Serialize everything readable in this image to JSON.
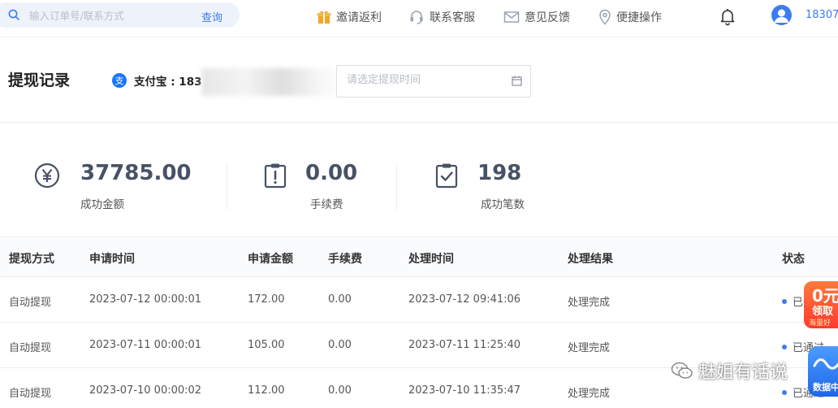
{
  "search": {
    "placeholder": "输入订单号/联系方式",
    "button_label": "查询"
  },
  "nav": {
    "items": [
      {
        "label": "邀请返利",
        "icon": "gift-icon",
        "color": "#f5a623"
      },
      {
        "label": "联系客服",
        "icon": "headset-icon"
      },
      {
        "label": "意见反馈",
        "icon": "mail-icon"
      },
      {
        "label": "便捷操作",
        "icon": "location-pin-icon"
      }
    ],
    "username": "18307"
  },
  "page": {
    "title": "提现记录",
    "account_label": "支付宝 : 183",
    "account_logo_glyph": "支",
    "date_placeholder": "请选定提现时间"
  },
  "stats": [
    {
      "value": "37785.00",
      "label": "成功金额",
      "icon": "yen-circle-icon"
    },
    {
      "value": "0.00",
      "label": "手续费",
      "icon": "alert-clipboard-icon"
    },
    {
      "value": "198",
      "label": "成功笔数",
      "icon": "check-clipboard-icon"
    }
  ],
  "table": {
    "headers": [
      "提现方式",
      "申请时间",
      "申请金额",
      "手续费",
      "处理时间",
      "处理结果",
      "状态"
    ],
    "rows": [
      {
        "method": "自动提现",
        "apply_time": "2023-07-12 00:00:01",
        "amount": "172.00",
        "fee": "0.00",
        "process_time": "2023-07-12 09:41:06",
        "result": "处理完成",
        "status": "已通过"
      },
      {
        "method": "自动提现",
        "apply_time": "2023-07-11 00:00:01",
        "amount": "105.00",
        "fee": "0.00",
        "process_time": "2023-07-11 11:25:40",
        "result": "处理完成",
        "status": "已通过"
      },
      {
        "method": "自动提现",
        "apply_time": "2023-07-10 00:00:02",
        "amount": "112.00",
        "fee": "0.00",
        "process_time": "2023-07-10 11:35:47",
        "result": "处理完成",
        "status": "已通过"
      }
    ]
  },
  "overlays": {
    "promo_big": "0元",
    "promo_mid": "领取",
    "promo_small": "海量好",
    "watermark": "魅姐有话说",
    "data_badge": "数据中"
  },
  "colors": {
    "accent": "#3d7cf0",
    "alipay": "#1677ff",
    "stat_value": "#475266"
  }
}
